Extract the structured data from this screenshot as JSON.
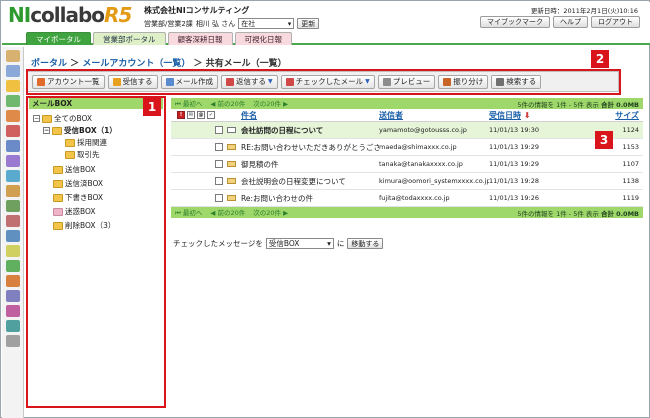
{
  "header": {
    "logo_ni": "NI",
    "logo_collabo": "collabo",
    "logo_r5": "R5",
    "company": "株式会社NIコンサルティング",
    "department": "営業部/営業2課",
    "user": "相川 弘 さん",
    "status_value": "在社",
    "update_button": "更新",
    "datetime": "更新日時：2011年2月1日(火)10:16",
    "buttons": [
      "マイブックマーク",
      "ヘルプ",
      "ログアウト"
    ]
  },
  "tabs": [
    {
      "label": "マイポータル",
      "style": "active"
    },
    {
      "label": "営業部ポータル",
      "style": "green"
    },
    {
      "label": "顧客深耕日報",
      "style": "pink"
    },
    {
      "label": "可視化日報",
      "style": "pink"
    }
  ],
  "breadcrumb": {
    "items": [
      "ポータル",
      "メールアカウント（一覧）"
    ],
    "separator": "＞",
    "current": "共有メール（一覧）"
  },
  "toolbar": {
    "buttons": [
      {
        "label": "アカウント一覧",
        "icon": "account-list-icon",
        "color": "#e06a2a"
      },
      {
        "label": "受信する",
        "icon": "receive-icon",
        "color": "#e8a020"
      },
      {
        "label": "メール作成",
        "icon": "compose-icon",
        "color": "#5a8ad0"
      },
      {
        "label": "返信する",
        "icon": "reply-icon",
        "color": "#d04848",
        "dropdown": true
      },
      {
        "label": "チェックしたメール",
        "icon": "checked-mail-icon",
        "color": "#d04848",
        "dropdown": true
      },
      {
        "label": "プレビュー",
        "icon": "preview-icon",
        "color": "#8c8c8c"
      },
      {
        "label": "振り分け",
        "icon": "sort-icon",
        "color": "#c86428"
      },
      {
        "label": "検索する",
        "icon": "search-icon",
        "color": "#707070"
      }
    ]
  },
  "annotations": [
    "1",
    "2",
    "3"
  ],
  "mailbox": {
    "title": "メールBOX",
    "nodes": [
      {
        "label": "全てのBOX",
        "level": 0,
        "expander": "−",
        "folder": "yellow",
        "bold": false
      },
      {
        "label": "受信BOX（1）",
        "level": 1,
        "expander": "−",
        "folder": "yellow",
        "bold": true
      },
      {
        "label": "採用関連",
        "level": 2,
        "expander": "",
        "folder": "yellow",
        "bold": false
      },
      {
        "label": "取引先",
        "level": 2,
        "expander": "",
        "folder": "yellow",
        "bold": false
      },
      {
        "label": "送信BOX",
        "level": 1,
        "expander": "",
        "folder": "yellow",
        "bold": false
      },
      {
        "label": "送信済BOX",
        "level": 1,
        "expander": "",
        "folder": "yellow",
        "bold": false
      },
      {
        "label": "下書きBOX",
        "level": 1,
        "expander": "",
        "folder": "yellow",
        "bold": false
      },
      {
        "label": "迷惑BOX",
        "level": 1,
        "expander": "",
        "folder": "pink",
        "bold": false
      },
      {
        "label": "削除BOX（3）",
        "level": 1,
        "expander": "",
        "folder": "yellow",
        "bold": false
      }
    ]
  },
  "list": {
    "nav": [
      "最初へ",
      "前の20件",
      "次の20件"
    ],
    "summary": "5件の情報を 1件 - 5件 表示",
    "total_label": "合計",
    "total_value": "0.0MB",
    "columns": {
      "subject": "件名",
      "from": "送信者",
      "date": "受信日時",
      "size": "サイズ"
    },
    "rows": [
      {
        "subject": "会社訪問の日程について",
        "from": "yamamoto@gotousss.co.jp",
        "date": "11/01/13 19:30",
        "size": "1124",
        "unread": true,
        "icon": "closed"
      },
      {
        "subject": "RE:お問い合わせいただきありがとうござ...",
        "from": "maeda@shimaxxx.co.jp",
        "date": "11/01/13 19:29",
        "size": "1153",
        "unread": false,
        "icon": "open"
      },
      {
        "subject": "御見積の件",
        "from": "tanaka@tanakaxxxx.co.jp",
        "date": "11/01/13 19:29",
        "size": "1107",
        "unread": false,
        "icon": "open"
      },
      {
        "subject": "会社説明会の日程変更について",
        "from": "kimura@oomori_systemxxxx.co.jp",
        "date": "11/01/13 19:28",
        "size": "1138",
        "unread": false,
        "icon": "open"
      },
      {
        "subject": "Re:お問い合わせの件",
        "from": "fujita@todaxxxx.co.jp",
        "date": "11/01/13 19:26",
        "size": "1119",
        "unread": false,
        "icon": "open"
      }
    ]
  },
  "move": {
    "prefix": "チェックしたメッセージを",
    "select_value": "受信BOX",
    "suffix": "に",
    "button": "移動する"
  },
  "colors": {
    "brand_green": "#3fa33f",
    "header_green": "#9fd86a",
    "link_blue": "#1a5fa8",
    "annotation_red": "#d9151b"
  }
}
